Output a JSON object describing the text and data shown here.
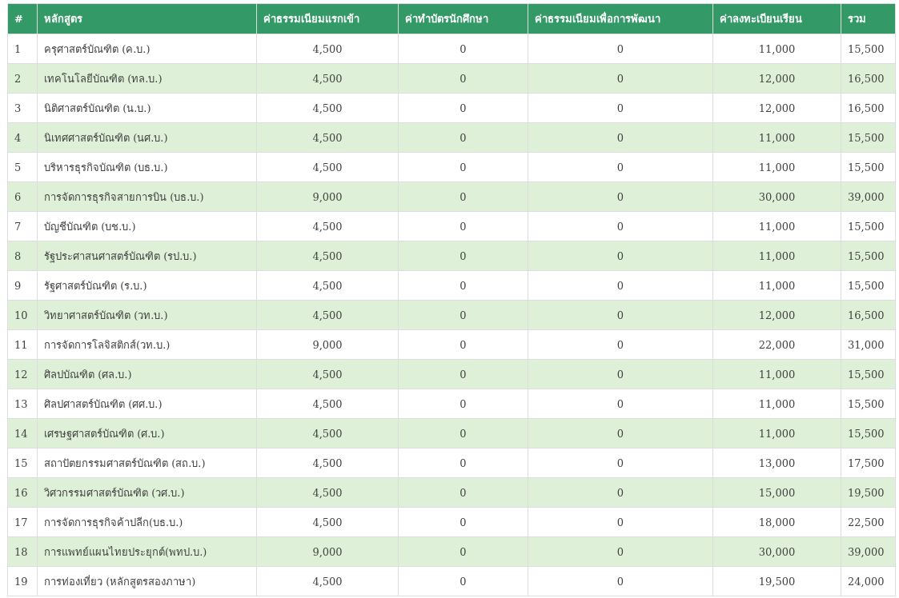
{
  "table": {
    "columns": [
      "#",
      "หลักสูตร",
      "ค่าธรรมเนียมแรกเข้า",
      "ค่าทำบัตรนักศึกษา",
      "ค่าธรรมเนียมเพื่อการพัฒนา",
      "ค่าลงทะเบียนเรียน",
      "รวม"
    ],
    "rows": [
      [
        "1",
        "ครุศาสตร์บัณฑิต (ค.บ.)",
        "4,500",
        "0",
        "0",
        "11,000",
        "15,500"
      ],
      [
        "2",
        "เทคโนโลยีบัณฑิต (ทล.บ.)",
        "4,500",
        "0",
        "0",
        "12,000",
        "16,500"
      ],
      [
        "3",
        "นิติศาสตร์บัณฑิต (น.บ.)",
        "4,500",
        "0",
        "0",
        "12,000",
        "16,500"
      ],
      [
        "4",
        "นิเทศศาสตร์บัณฑิต (นศ.บ.)",
        "4,500",
        "0",
        "0",
        "11,000",
        "15,500"
      ],
      [
        "5",
        "บริหารธุรกิจบัณฑิต (บธ.บ.)",
        "4,500",
        "0",
        "0",
        "11,000",
        "15,500"
      ],
      [
        "6",
        "การจัดการธุรกิจสายการบิน (บธ.บ.)",
        "9,000",
        "0",
        "0",
        "30,000",
        "39,000"
      ],
      [
        "7",
        "บัญชีบัณฑิต (บช.บ.)",
        "4,500",
        "0",
        "0",
        "11,000",
        "15,500"
      ],
      [
        "8",
        "รัฐประศาสนศาสตร์บัณฑิต (รป.บ.)",
        "4,500",
        "0",
        "0",
        "11,000",
        "15,500"
      ],
      [
        "9",
        "รัฐศาสตร์บัณฑิต (ร.บ.)",
        "4,500",
        "0",
        "0",
        "11,000",
        "15,500"
      ],
      [
        "10",
        "วิทยาศาสตร์บัณฑิต (วท.บ.)",
        "4,500",
        "0",
        "0",
        "12,000",
        "16,500"
      ],
      [
        "11",
        "การจัดการโลจิสติกส์(วท.บ.)",
        "9,000",
        "0",
        "0",
        "22,000",
        "31,000"
      ],
      [
        "12",
        "ศิลปบัณฑิต (ศล.บ.)",
        "4,500",
        "0",
        "0",
        "11,000",
        "15,500"
      ],
      [
        "13",
        "ศิลปศาสตร์บัณฑิต (ศศ.บ.)",
        "4,500",
        "0",
        "0",
        "11,000",
        "15,500"
      ],
      [
        "14",
        "เศรษฐศาสตร์บัณฑิต (ศ.บ.)",
        "4,500",
        "0",
        "0",
        "11,000",
        "15,500"
      ],
      [
        "15",
        "สถาปัตยกรรมศาสตร์บัณฑิต (สถ.บ.)",
        "4,500",
        "0",
        "0",
        "13,000",
        "17,500"
      ],
      [
        "16",
        "วิศวกรรมศาสตร์บัณฑิต (วศ.บ.)",
        "4,500",
        "0",
        "0",
        "15,000",
        "19,500"
      ],
      [
        "17",
        "การจัดการธุรกิจค้าปลีก(บธ.บ.)",
        "4,500",
        "0",
        "0",
        "18,000",
        "22,500"
      ],
      [
        "18",
        "การแพทย์แผนไทยประยุกต์(พทป.บ.)",
        "9,000",
        "0",
        "0",
        "30,000",
        "39,000"
      ],
      [
        "19",
        "การท่องเที่ยว (หลักสูตรสองภาษา)",
        "4,500",
        "0",
        "0",
        "19,500",
        "24,000"
      ]
    ]
  }
}
